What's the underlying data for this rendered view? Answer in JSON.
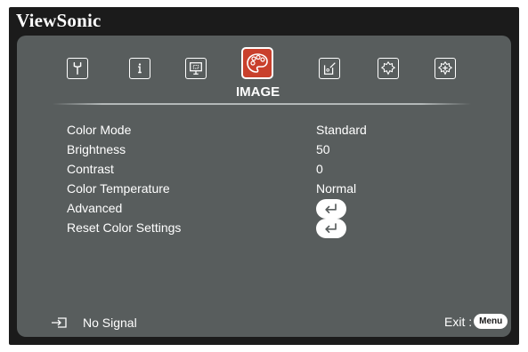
{
  "brand": "ViewSonic",
  "tabs": [
    {
      "icon": "wrench-icon",
      "label": ""
    },
    {
      "icon": "info-icon",
      "label": ""
    },
    {
      "icon": "display-icon",
      "label": ""
    },
    {
      "icon": "palette-icon",
      "label": "IMAGE",
      "active": true
    },
    {
      "icon": "settings-icon",
      "label": ""
    },
    {
      "icon": "gear-icon",
      "label": ""
    },
    {
      "icon": "advanced-gear-icon",
      "label": ""
    }
  ],
  "menu": {
    "items": [
      {
        "label": "Color Mode",
        "value": "Standard"
      },
      {
        "label": "Brightness",
        "value": "50"
      },
      {
        "label": "Contrast",
        "value": "0"
      },
      {
        "label": "Color Temperature",
        "value": "Normal"
      },
      {
        "label": "Advanced",
        "value": null,
        "action": "enter-icon"
      },
      {
        "label": "Reset Color Settings",
        "value": null,
        "action": "enter-icon"
      }
    ]
  },
  "footer": {
    "signal_text": "No Signal",
    "exit_label": "Exit :",
    "menu_key": "Menu"
  },
  "colors": {
    "panel": "#585d5d",
    "frame": "#1b1b1b",
    "active_tab": "#c9402c"
  }
}
